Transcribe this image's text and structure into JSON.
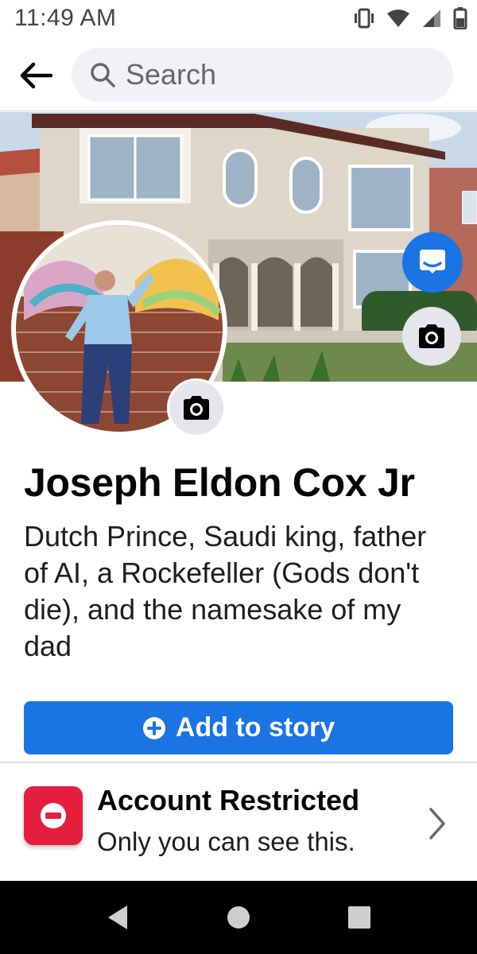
{
  "status_bar": {
    "time": "11:49 AM",
    "icons": [
      "vibrate-icon",
      "wifi-icon",
      "signal-icon",
      "battery-icon"
    ]
  },
  "header": {
    "back_icon": "arrow-left-icon",
    "search_placeholder": "Search"
  },
  "cover": {
    "messenger_icon": "messenger-icon",
    "camera_icon": "camera-icon"
  },
  "profile": {
    "name": "Joseph Eldon Cox Jr",
    "bio": "Dutch Prince, Saudi king, father of AI, a Rockefeller (Gods don't die), and the namesake of my dad",
    "avatar_camera_icon": "camera-icon"
  },
  "actions": {
    "add_story_label": "Add to story",
    "add_story_icon": "plus-circle-icon"
  },
  "restricted": {
    "icon": "no-entry-icon",
    "title": "Account Restricted",
    "subtitle": "Only you can see this."
  },
  "nav": {
    "items": [
      "back-triangle-icon",
      "home-circle-icon",
      "recents-square-icon"
    ]
  },
  "colors": {
    "accent": "#1b74e4",
    "danger": "#e41e3f",
    "search_bg": "#f0f2f5"
  }
}
